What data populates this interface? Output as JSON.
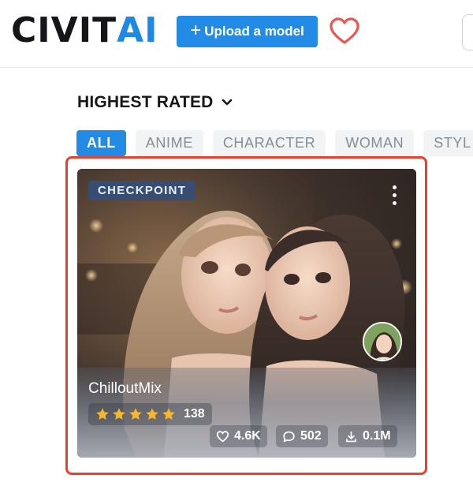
{
  "header": {
    "logo_part1": "CIVIT",
    "logo_part2": "AI",
    "upload_label": "Upload a model",
    "upload_icon": "plus-icon",
    "favorites_icon": "heart-icon"
  },
  "section": {
    "title": "HIGHEST RATED",
    "sort_icon": "chevron-down-icon"
  },
  "tags": [
    {
      "label": "ALL",
      "active": true
    },
    {
      "label": "ANIME",
      "active": false
    },
    {
      "label": "CHARACTER",
      "active": false
    },
    {
      "label": "WOMAN",
      "active": false
    },
    {
      "label": "STYL",
      "active": false
    }
  ],
  "card": {
    "type_badge": "CHECKPOINT",
    "name": "ChilloutMix",
    "stars": 5,
    "rating_count": "138",
    "favorites": "4.6K",
    "comments": "502",
    "downloads": "0.1M",
    "menu_icon": "kebab-menu-icon"
  },
  "colors": {
    "brand_dark": "#14161a",
    "brand_blue": "#1e88e5",
    "accent_button": "#228be6",
    "heart": "#e8574f",
    "highlight": "#e8412d",
    "star": "#f8b62d"
  }
}
